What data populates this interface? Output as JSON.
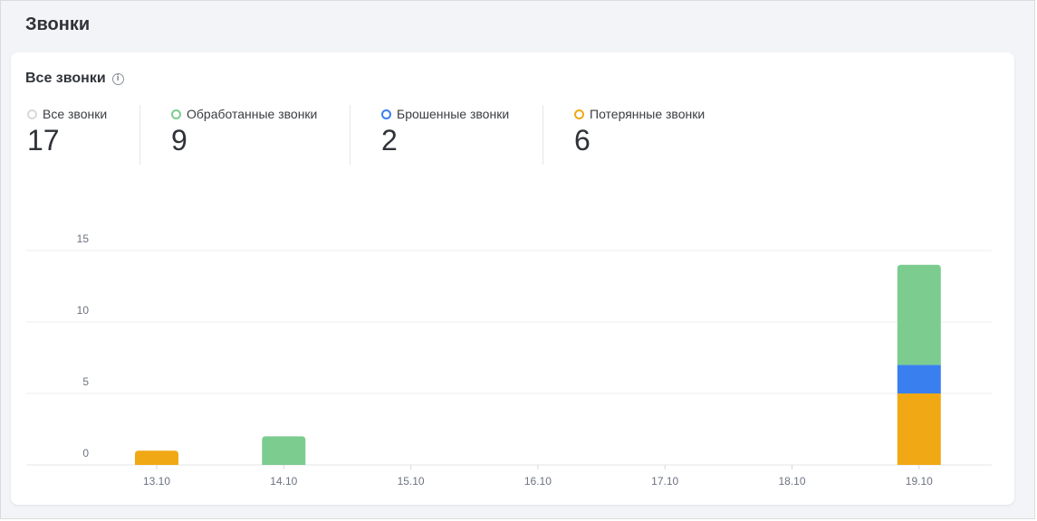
{
  "page": {
    "title": "Звонки"
  },
  "card": {
    "title": "Все звонки"
  },
  "stats": [
    {
      "label": "Все звонки",
      "value": "17",
      "color": "#d9d9d9"
    },
    {
      "label": "Обработанные звонки",
      "value": "9",
      "color": "#7ccc8f"
    },
    {
      "label": "Брошенные звонки",
      "value": "2",
      "color": "#3a7ff0"
    },
    {
      "label": "Потерянные звонки",
      "value": "6",
      "color": "#f0a915"
    }
  ],
  "chart_data": {
    "type": "bar",
    "stacked": true,
    "categories": [
      "13.10",
      "14.10",
      "15.10",
      "16.10",
      "17.10",
      "18.10",
      "19.10"
    ],
    "series": [
      {
        "name": "Потерянные звонки",
        "color": "#f0a915",
        "values": [
          1,
          0,
          0,
          0,
          0,
          0,
          5
        ]
      },
      {
        "name": "Брошенные звонки",
        "color": "#3a7ff0",
        "values": [
          0,
          0,
          0,
          0,
          0,
          0,
          2
        ]
      },
      {
        "name": "Обработанные звонки",
        "color": "#7ccc8f",
        "values": [
          0,
          2,
          0,
          0,
          0,
          0,
          7
        ]
      }
    ],
    "yticks": [
      0,
      5,
      10,
      15
    ],
    "ylim": [
      0,
      15
    ],
    "grid": true
  }
}
